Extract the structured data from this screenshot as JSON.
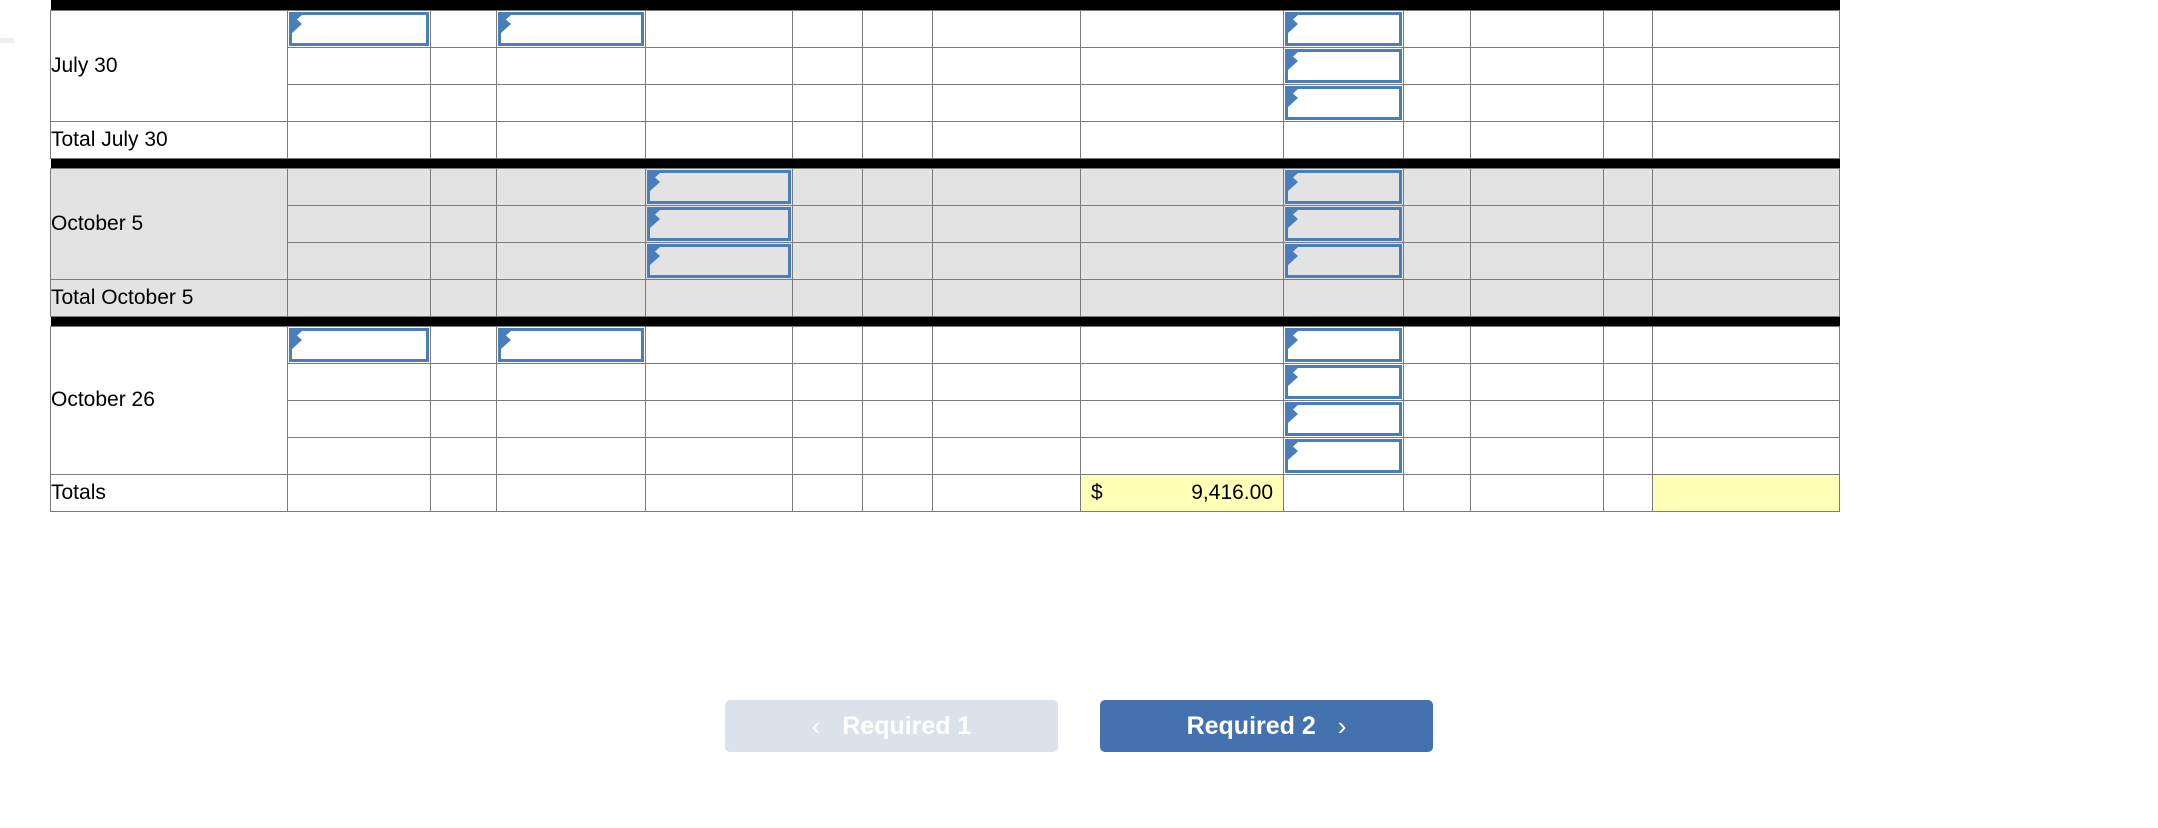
{
  "worksheet": {
    "sections": [
      {
        "id": "july-30",
        "label": "July 30",
        "total_label": "Total July 30",
        "shaded": false,
        "entry_rows": 3
      },
      {
        "id": "october-5",
        "label": "October 5",
        "total_label": "Total October 5",
        "shaded": true,
        "entry_rows": 3
      },
      {
        "id": "october-26",
        "label": "October 26",
        "total_label": "Totals",
        "shaded": false,
        "entry_rows": 4
      }
    ],
    "totals": {
      "label": "Totals",
      "amount_symbol": "$",
      "amount_value": "9,416.00",
      "final_cell_value": ""
    }
  },
  "nav": {
    "prev": {
      "label": "Required 1",
      "icon": "chevron-left-icon",
      "glyph": "‹",
      "enabled": false,
      "color": "#dbe2ec"
    },
    "next": {
      "label": "Required 2",
      "icon": "chevron-right-icon",
      "glyph": "›",
      "enabled": true,
      "color": "#4472ae"
    }
  },
  "colors": {
    "input_border": "#4a7ebb",
    "shaded_row": "#e3e3e3",
    "answer_highlight": "#ffffb8",
    "grid_line": "#7b7b7b",
    "separator": "#000000"
  }
}
